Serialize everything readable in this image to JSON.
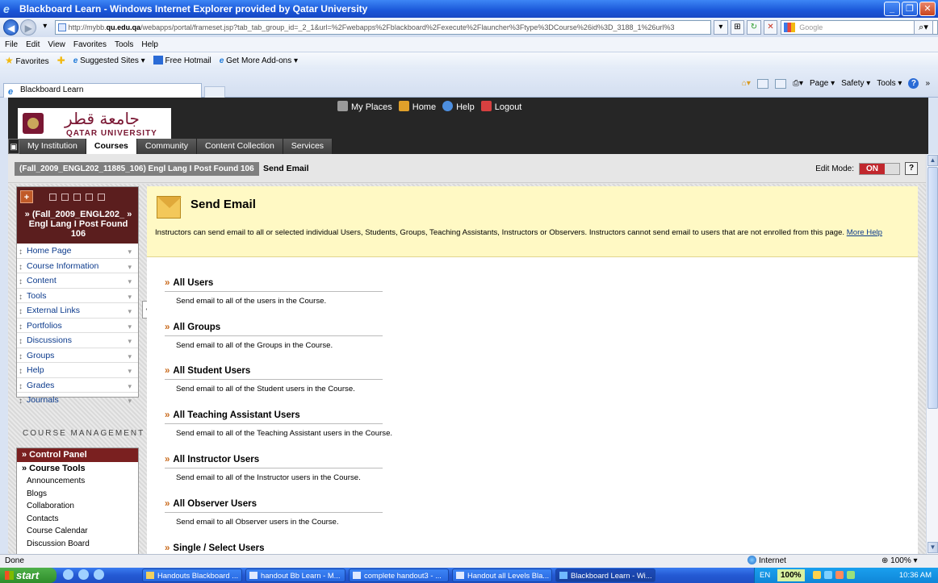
{
  "window": {
    "title": "Blackboard Learn - Windows Internet Explorer provided by Qatar University",
    "minimize": "_",
    "maximize": "❐",
    "close": "✕"
  },
  "address": {
    "url_pre": "http://mybb.",
    "url_domain": "qu.edu.qa",
    "url_post": "/webapps/portal/frameset.jsp?tab_tab_group_id=_2_1&url=%2Fwebapps%2Fblackboard%2Fexecute%2Flauncher%3Ftype%3DCourse%26id%3D_3188_1%26url%3",
    "search_placeholder": "Google"
  },
  "menubar": [
    "File",
    "Edit",
    "View",
    "Favorites",
    "Tools",
    "Help"
  ],
  "favbar": {
    "favorites": "Favorites",
    "suggested": "Suggested Sites ▾",
    "hotmail": "Free Hotmail",
    "addons": "Get More Add-ons ▾"
  },
  "ie_tab": {
    "label": "Blackboard Learn"
  },
  "commandbar": {
    "page": "Page ▾",
    "safety": "Safety ▾",
    "tools": "Tools ▾",
    "help": "?",
    "more": "»"
  },
  "bb": {
    "logo_ar": "جامعة قطر",
    "logo_en": "QATAR UNIVERSITY",
    "toplinks": [
      {
        "label": "My Places",
        "color": "#9a9a9a"
      },
      {
        "label": "Home",
        "color": "#e0a02a"
      },
      {
        "label": "Help",
        "color": "#4d8fe0"
      },
      {
        "label": "Logout",
        "color": "#d64040"
      }
    ],
    "tabs": [
      "My Institution",
      "Courses",
      "Community",
      "Content Collection",
      "Services"
    ],
    "active_tab": "Courses"
  },
  "breadcrumb": {
    "course": "(Fall_2009_ENGL202_11885_106) Engl Lang I Post Found 106",
    "current": "Send Email",
    "edit_mode_label": "Edit Mode:",
    "edit_mode_value": "ON",
    "help": "?"
  },
  "course_menu": {
    "plus": "+",
    "title": "» (Fall_2009_ENGL202_ » Engl Lang I Post Found 106",
    "items": [
      "Home Page",
      "Course Information",
      "Content",
      "Tools",
      "External Links",
      "Portfolios",
      "Discussions",
      "Groups",
      "Help",
      "Grades",
      "Journals"
    ],
    "collapse": "‹"
  },
  "course_management": {
    "label": "COURSE MANAGEMENT",
    "control_panel": "» Control Panel",
    "course_tools": "» Course Tools",
    "tools": [
      "Announcements",
      "Blogs",
      "Collaboration",
      "Contacts",
      "Course Calendar",
      "Discussion Board"
    ]
  },
  "main": {
    "title": "Send Email",
    "description": "Instructors can send email to all or selected individual Users, Students, Groups, Teaching Assistants, Instructors or Observers. Instructors cannot send email to users that are not enrolled from this page.",
    "more_help": "More Help",
    "options": [
      {
        "title": "All Users",
        "desc": "Send email to all of the users in the Course."
      },
      {
        "title": "All Groups",
        "desc": "Send email to all of the Groups in the Course."
      },
      {
        "title": "All Student Users",
        "desc": "Send email to all of the Student users in the Course."
      },
      {
        "title": "All Teaching Assistant Users",
        "desc": "Send email to all of the Teaching Assistant users in the Course."
      },
      {
        "title": "All Instructor Users",
        "desc": "Send email to all of the Instructor users in the Course."
      },
      {
        "title": "All Observer Users",
        "desc": "Send email to all Observer users in the Course."
      },
      {
        "title": "Single / Select Users",
        "desc": ""
      }
    ]
  },
  "statusbar": {
    "text": "Done",
    "zone": "Internet",
    "zoom": "100%"
  },
  "taskbar": {
    "start": "start",
    "tasks": [
      "Handouts Blackboard ...",
      "handout Bb Learn - M...",
      "complete handout3 - ...",
      "Handout all Levels Bla...",
      "Blackboard Learn - Wi..."
    ],
    "active_task": 4,
    "lang": "EN",
    "battery": "100%",
    "clock": "10:36 AM"
  }
}
